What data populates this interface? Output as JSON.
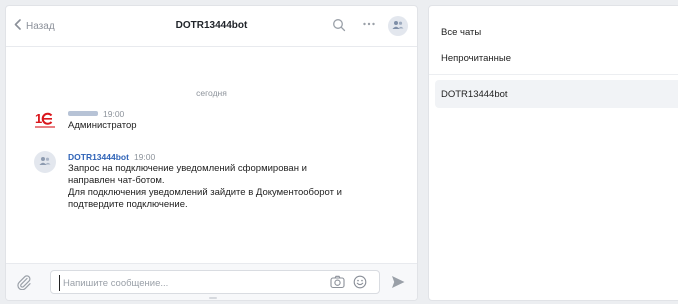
{
  "header": {
    "back_label": "Назад",
    "title": "DOTR13444bot"
  },
  "conversation": {
    "date_separator": "сегодня",
    "messages": [
      {
        "sender": "",
        "time": "19:00",
        "text_lines": [
          "Администратор"
        ]
      },
      {
        "sender": "DOTR13444bot",
        "time": "19:00",
        "text_lines": [
          "Запрос на подключение уведомлений сформирован и",
          "направлен чат-ботом.",
          "Для подключения уведомлений зайдите в Документооборот и",
          "подтвердите подключение."
        ]
      }
    ]
  },
  "composer": {
    "placeholder": "Напишите сообщение...",
    "value": ""
  },
  "chat_list": {
    "filters": [
      "Все чаты",
      "Непрочитанные"
    ],
    "chats": [
      {
        "name": "DOTR13444bot",
        "selected": true
      }
    ]
  },
  "colors": {
    "accent": "#2f63b7",
    "logo_red": "#d9161c",
    "background": "#eceef1",
    "panel": "#ffffff"
  },
  "icons": {
    "back": "chevron-left-icon",
    "search": "search-icon",
    "more": "more-icon",
    "members": "members-icon",
    "attach": "paperclip-icon",
    "camera": "camera-icon",
    "emoji": "emoji-icon",
    "send": "send-icon"
  }
}
